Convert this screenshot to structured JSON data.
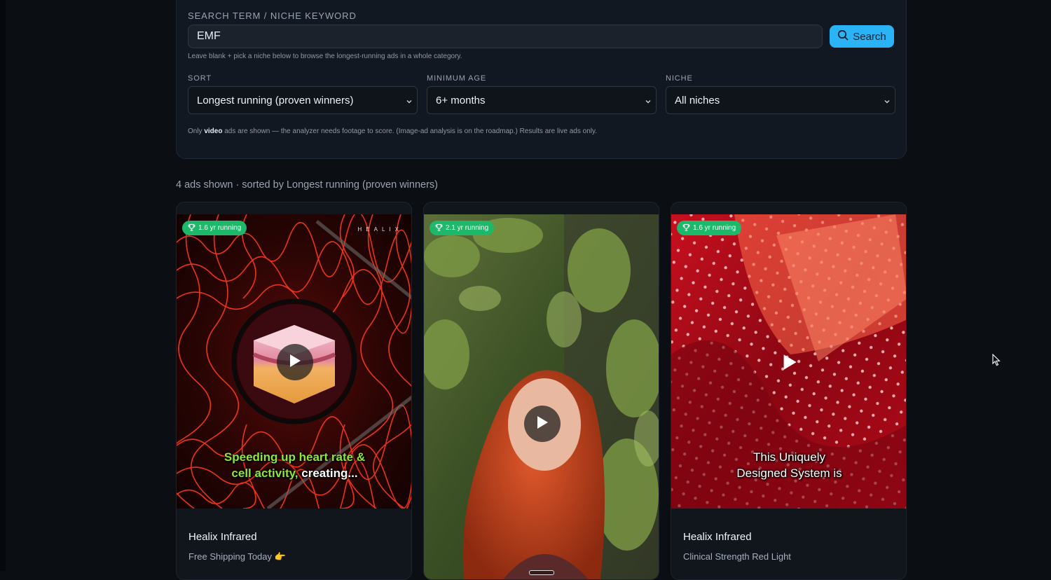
{
  "search": {
    "label": "SEARCH TERM / NICHE KEYWORD",
    "value": "EMF",
    "button_label": "Search",
    "hint": "Leave blank + pick a niche below to browse the longest-running ads in a whole category."
  },
  "filters": {
    "sort": {
      "label": "SORT",
      "value": "Longest running (proven winners)"
    },
    "min_age": {
      "label": "MINIMUM AGE",
      "value": "6+ months"
    },
    "niche": {
      "label": "NICHE",
      "value": "All niches"
    }
  },
  "note": {
    "prefix": "Only ",
    "bold": "video",
    "suffix": " ads are shown — the analyzer needs footage to score. (Image-ad analysis is on the roadmap.) Results are live ads only."
  },
  "results": {
    "summary": "4 ads shown · sorted by Longest running (proven winners)"
  },
  "cards": [
    {
      "badge": "1.6 yr running",
      "logo_text": "HEALIX",
      "caption_line1": "Speeding up heart rate &",
      "caption_line2_a": "cell activity,",
      "caption_line2_b": " creating...",
      "title": "Healix Infrared",
      "subtitle": "Free Shipping Today 👉"
    },
    {
      "badge": "2.1 yr running"
    },
    {
      "badge": "1.6 yr running",
      "caption_line1": "This Uniquely",
      "caption_line2": "Designed System is",
      "title": "Healix Infrared",
      "subtitle": "Clinical Strength Red Light"
    }
  ],
  "icons": {
    "search_button": "search-icon",
    "badge": "trophy-icon",
    "select": "chevron-down-icon",
    "video": "play-icon",
    "pointer": "mouse-cursor-icon"
  },
  "colors": {
    "accent": "#2ab4f5",
    "badge": "#1db86a",
    "background": "#0b0e13",
    "panel": "#121821",
    "caption_green": "#8ee63b"
  }
}
